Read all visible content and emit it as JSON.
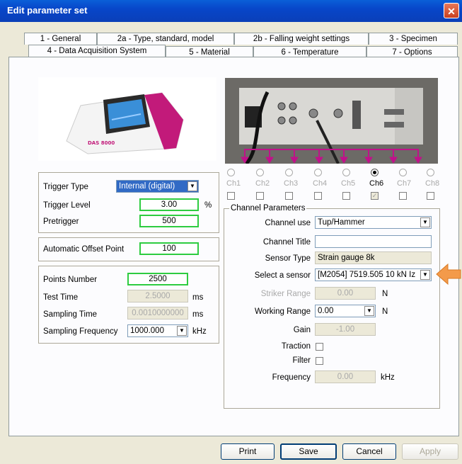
{
  "window": {
    "title": "Edit parameter set",
    "close_symbol": "✕"
  },
  "tabs_row1": [
    {
      "label": "1 - General"
    },
    {
      "label": "2a - Type, standard, model"
    },
    {
      "label": "2b - Falling weight settings"
    },
    {
      "label": "3 - Specimen"
    }
  ],
  "tabs_row2": [
    {
      "label": "4 - Data Acquisition System",
      "active": true
    },
    {
      "label": "5 - Material"
    },
    {
      "label": "6 - Temperature"
    },
    {
      "label": "7 - Options"
    }
  ],
  "device_image": {
    "brand_text": "DAS 8000"
  },
  "trigger": {
    "type_label": "Trigger Type",
    "type_value": "Internal (digital)",
    "level_label": "Trigger Level",
    "level_value": "3.00",
    "level_unit": "%",
    "pretrigger_label": "Pretrigger",
    "pretrigger_value": "500"
  },
  "offset": {
    "label": "Automatic Offset Point",
    "value": "100"
  },
  "sampling": {
    "points_label": "Points Number",
    "points_value": "2500",
    "test_time_label": "Test Time",
    "test_time_value": "2.5000",
    "test_time_unit": "ms",
    "sampling_time_label": "Sampling Time",
    "sampling_time_value": "0.0010000000",
    "sampling_time_unit": "ms",
    "freq_label": "Sampling Frequency",
    "freq_value": "1000.000",
    "freq_unit": "kHz"
  },
  "channels": [
    {
      "label": "Ch1",
      "selected": false,
      "checked": false
    },
    {
      "label": "Ch2",
      "selected": false,
      "checked": false
    },
    {
      "label": "Ch3",
      "selected": false,
      "checked": false
    },
    {
      "label": "Ch4",
      "selected": false,
      "checked": false
    },
    {
      "label": "Ch5",
      "selected": false,
      "checked": false
    },
    {
      "label": "Ch6",
      "selected": true,
      "checked": true
    },
    {
      "label": "Ch7",
      "selected": false,
      "checked": false
    },
    {
      "label": "Ch8",
      "selected": false,
      "checked": false
    }
  ],
  "channel_params": {
    "legend": "Channel Parameters",
    "use_label": "Channel use",
    "use_value": "Tup/Hammer",
    "title_label": "Channel Title",
    "title_value": "",
    "sensor_type_label": "Sensor Type",
    "sensor_type_value": "Strain gauge 8k",
    "select_sensor_label": "Select a sensor",
    "select_sensor_value": "[M2054] 7519.505 10 kN Iz",
    "striker_label": "Striker Range",
    "striker_value": "0.00",
    "striker_unit": "N",
    "working_label": "Working Range",
    "working_value": "0.00",
    "working_unit": "N",
    "gain_label": "Gain",
    "gain_value": "-1.00",
    "traction_label": "Traction",
    "filter_label": "Filter",
    "frequency_label": "Frequency",
    "frequency_value": "0.00",
    "frequency_unit": "kHz"
  },
  "buttons": {
    "print": "Print",
    "save": "Save",
    "cancel": "Cancel",
    "apply": "Apply"
  },
  "colors": {
    "accent_arrow": "#f39a4a",
    "channel_arrows": "#c0128a",
    "title_bar": "#0a4fc8"
  }
}
